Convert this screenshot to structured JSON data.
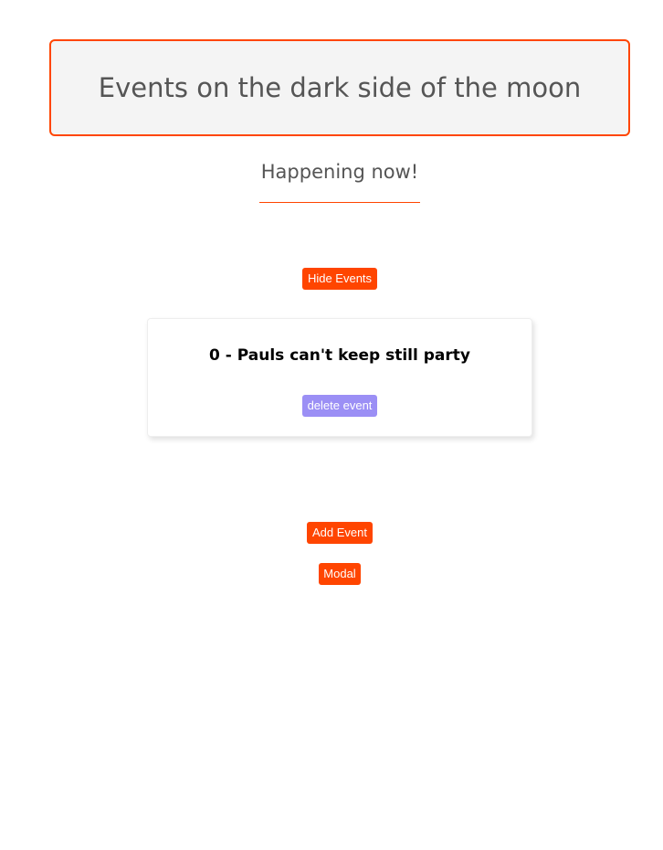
{
  "header": {
    "title": "Events on the dark side of the moon"
  },
  "subtitle": "Happening now!",
  "toolbar": {
    "hide_events_label": "Hide Events",
    "add_event_label": "Add Event",
    "modal_label": "Modal"
  },
  "events": [
    {
      "index": "0",
      "title": "0 - Pauls can't keep still party",
      "delete_label": "delete event"
    }
  ],
  "colors": {
    "accent": "#ff4500",
    "delete_button": "#9b8ff5",
    "title_background": "#f4f4f4",
    "text": "#555555"
  }
}
